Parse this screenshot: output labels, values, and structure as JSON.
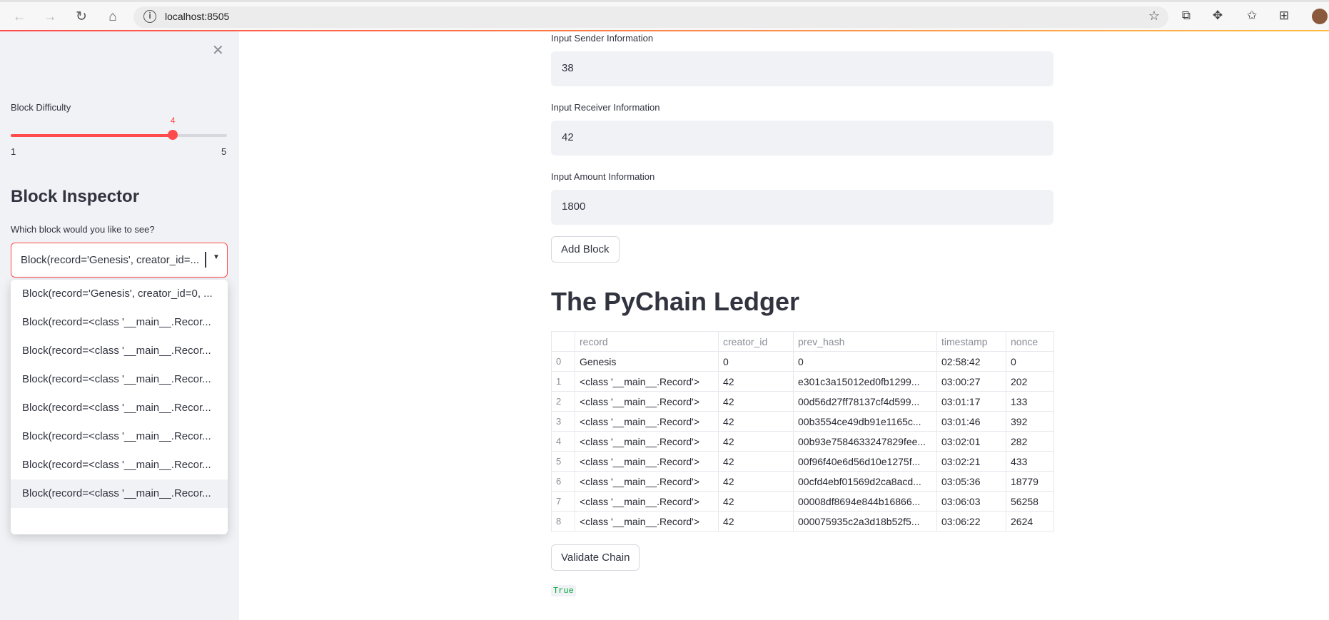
{
  "browser": {
    "url": "localhost:8505"
  },
  "sidebar": {
    "slider": {
      "label": "Block Difficulty",
      "value": 4,
      "min": 1,
      "max": 5,
      "value_text": "4",
      "min_text": "1",
      "max_text": "5"
    },
    "heading": "Block Inspector",
    "select_label": "Which block would you like to see?",
    "selected": "Block(record='Genesis', creator_id=...",
    "options": [
      "Block(record='Genesis', creator_id=0, ...",
      "Block(record=<class '__main__.Recor...",
      "Block(record=<class '__main__.Recor...",
      "Block(record=<class '__main__.Recor...",
      "Block(record=<class '__main__.Recor...",
      "Block(record=<class '__main__.Recor...",
      "Block(record=<class '__main__.Recor...",
      "Block(record=<class '__main__.Recor..."
    ]
  },
  "form": {
    "sender_label": "Input Sender Information",
    "sender_value": "38",
    "receiver_label": "Input Receiver Information",
    "receiver_value": "42",
    "amount_label": "Input Amount Information",
    "amount_value": "1800",
    "add_button": "Add Block"
  },
  "ledger": {
    "title": "The PyChain Ledger",
    "columns": [
      "",
      "record",
      "creator_id",
      "prev_hash",
      "timestamp",
      "nonce"
    ],
    "rows": [
      [
        "0",
        "Genesis",
        "0",
        "0",
        "02:58:42",
        "0"
      ],
      [
        "1",
        "<class '__main__.Record'>",
        "42",
        "e301c3a15012ed0fb1299...",
        "03:00:27",
        "202"
      ],
      [
        "2",
        "<class '__main__.Record'>",
        "42",
        "00d56d27ff78137cf4d599...",
        "03:01:17",
        "133"
      ],
      [
        "3",
        "<class '__main__.Record'>",
        "42",
        "00b3554ce49db91e1165c...",
        "03:01:46",
        "392"
      ],
      [
        "4",
        "<class '__main__.Record'>",
        "42",
        "00b93e7584633247829fee...",
        "03:02:01",
        "282"
      ],
      [
        "5",
        "<class '__main__.Record'>",
        "42",
        "00f96f40e6d56d10e1275f...",
        "03:02:21",
        "433"
      ],
      [
        "6",
        "<class '__main__.Record'>",
        "42",
        "00cfd4ebf01569d2ca8acd...",
        "03:05:36",
        "18779"
      ],
      [
        "7",
        "<class '__main__.Record'>",
        "42",
        "00008df8694e844b16866...",
        "03:06:03",
        "56258"
      ],
      [
        "8",
        "<class '__main__.Record'>",
        "42",
        "000075935c2a3d18b52f5...",
        "03:06:22",
        "2624"
      ]
    ],
    "validate_button": "Validate Chain",
    "result": "True"
  }
}
